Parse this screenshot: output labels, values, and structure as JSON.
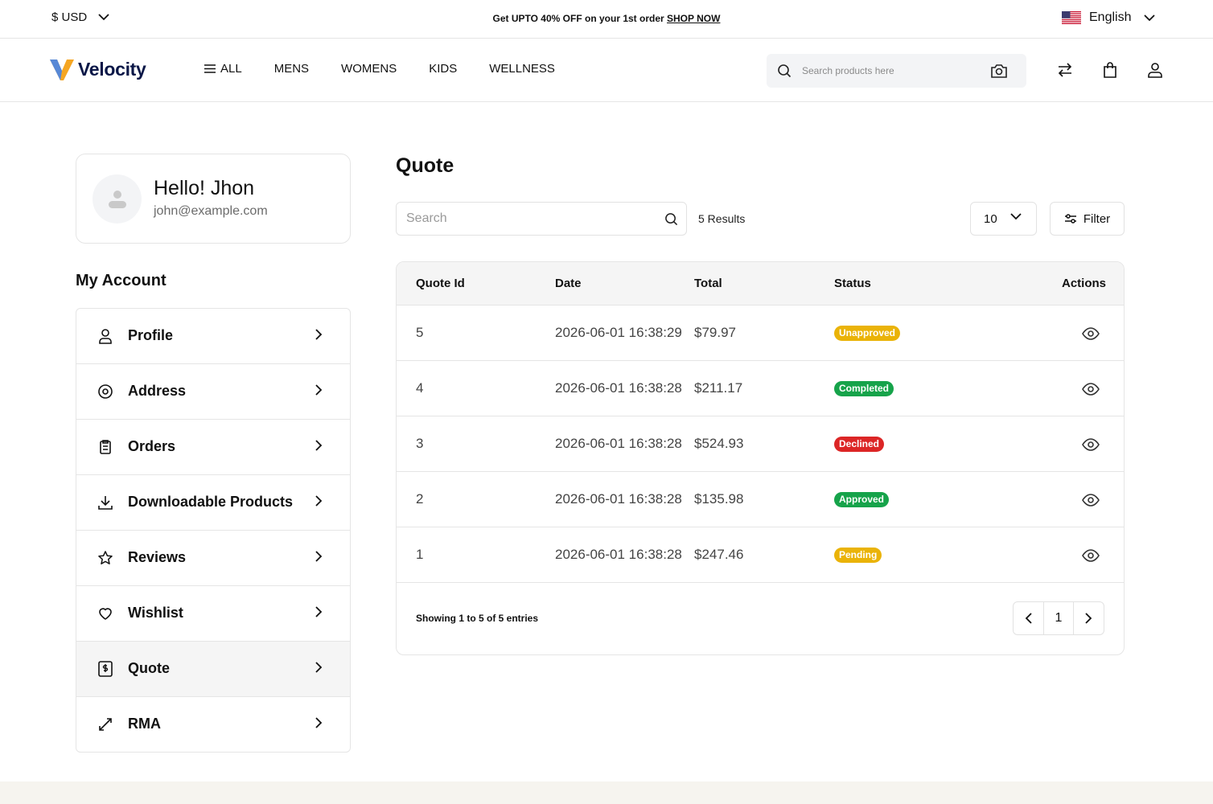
{
  "topbar": {
    "currency": "$ USD",
    "promo_text": "Get UPTO 40% OFF on your 1st order",
    "promo_link": "SHOP NOW",
    "language": "English"
  },
  "header": {
    "logo_text": "Velocity",
    "nav": [
      "ALL",
      "MENS",
      "WOMENS",
      "KIDS",
      "WELLNESS"
    ],
    "search_placeholder": "Search products here"
  },
  "profile": {
    "greeting": "Hello! Jhon",
    "email": "john@example.com"
  },
  "sidebar": {
    "heading": "My Account",
    "items": [
      {
        "label": "Profile",
        "icon": "user-icon"
      },
      {
        "label": "Address",
        "icon": "location-pin-icon"
      },
      {
        "label": "Orders",
        "icon": "clipboard-icon"
      },
      {
        "label": "Downloadable Products",
        "icon": "download-icon"
      },
      {
        "label": "Reviews",
        "icon": "star-icon"
      },
      {
        "label": "Wishlist",
        "icon": "heart-icon"
      },
      {
        "label": "Quote",
        "icon": "quote-document-icon",
        "active": true
      },
      {
        "label": "RMA",
        "icon": "exchange-icon"
      }
    ]
  },
  "main": {
    "title": "Quote",
    "search_placeholder": "Search",
    "results": "5 Results",
    "per_page": "10",
    "filter_label": "Filter",
    "columns": [
      "Quote Id",
      "Date",
      "Total",
      "Status",
      "Actions"
    ],
    "rows": [
      {
        "id": "5",
        "date": "2026-06-01 16:38:29",
        "total": "$79.97",
        "status": "Unapproved",
        "status_color": "#eab308"
      },
      {
        "id": "4",
        "date": "2026-06-01 16:38:28",
        "total": "$211.17",
        "status": "Completed",
        "status_color": "#16a34a"
      },
      {
        "id": "3",
        "date": "2026-06-01 16:38:28",
        "total": "$524.93",
        "status": "Declined",
        "status_color": "#dc2626"
      },
      {
        "id": "2",
        "date": "2026-06-01 16:38:28",
        "total": "$135.98",
        "status": "Approved",
        "status_color": "#16a34a"
      },
      {
        "id": "1",
        "date": "2026-06-01 16:38:28",
        "total": "$247.46",
        "status": "Pending",
        "status_color": "#eab308"
      }
    ],
    "showing": "Showing 1 to 5 of 5 entries",
    "current_page": "1"
  }
}
